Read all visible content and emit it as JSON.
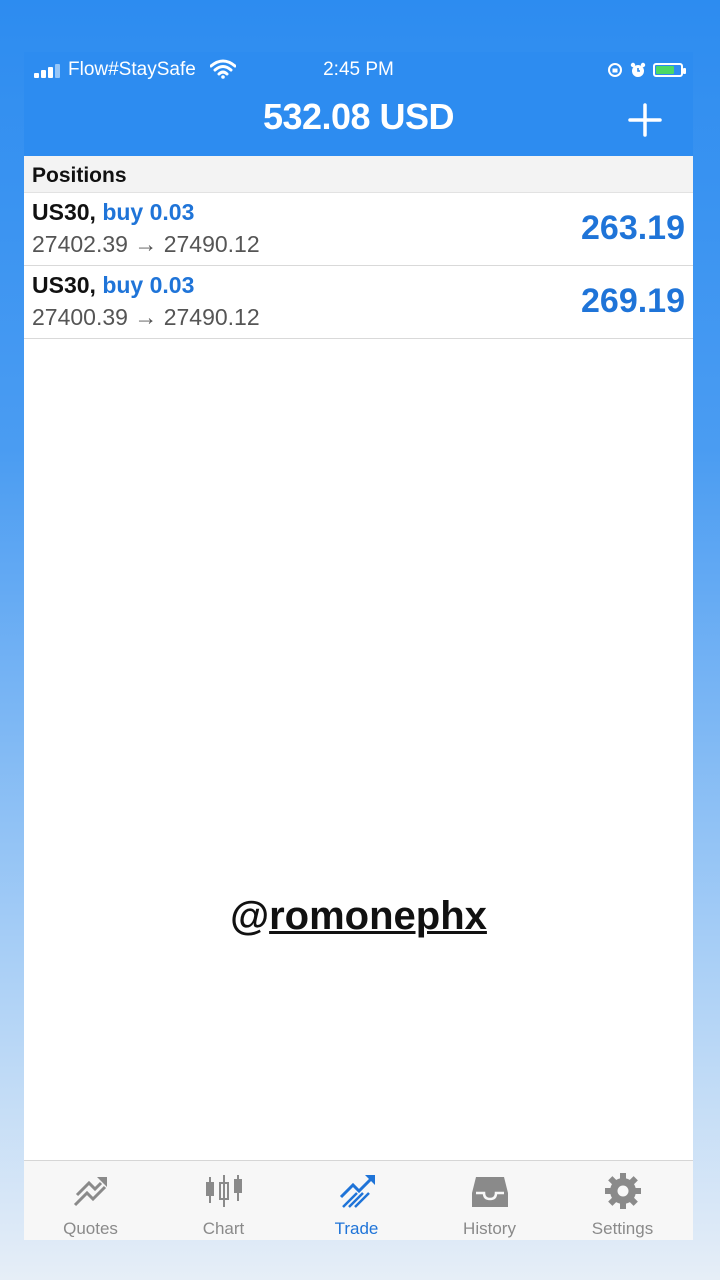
{
  "status": {
    "carrier": "Flow#StaySafe",
    "time": "2:45 PM"
  },
  "header": {
    "balance": "532.08 USD"
  },
  "positions": {
    "title": "Positions",
    "rows": [
      {
        "symbol": "US30,",
        "side": "buy 0.03",
        "prices": "27402.39 → 27490.12",
        "profit": "263.19"
      },
      {
        "symbol": "US30,",
        "side": "buy 0.03",
        "prices": "27400.39 → 27490.12",
        "profit": "269.19"
      }
    ]
  },
  "watermark": {
    "at": "@",
    "handle": "romonephx"
  },
  "tabs": [
    {
      "label": "Quotes",
      "icon": "quotes-icon",
      "active": false
    },
    {
      "label": "Chart",
      "icon": "chart-icon",
      "active": false
    },
    {
      "label": "Trade",
      "icon": "trade-icon",
      "active": true
    },
    {
      "label": "History",
      "icon": "history-icon",
      "active": false
    },
    {
      "label": "Settings",
      "icon": "gear-icon",
      "active": false
    }
  ],
  "colors": {
    "accent": "#2d8cf0",
    "profit": "#1f74d8",
    "battery": "#4cd964"
  }
}
